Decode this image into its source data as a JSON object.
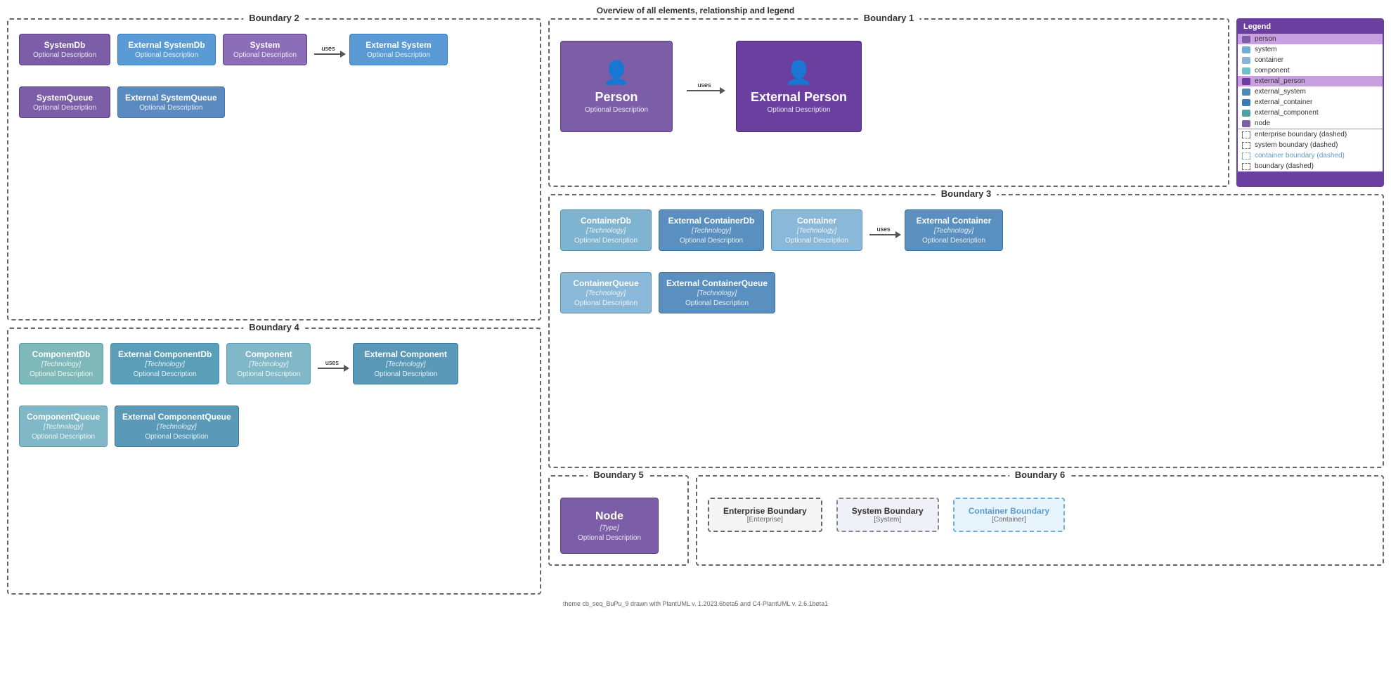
{
  "page": {
    "title": "Overview of all elements, relationship and legend"
  },
  "legend": {
    "header": "Legend",
    "items": [
      {
        "label": "person",
        "type": "person"
      },
      {
        "label": "system",
        "type": "system"
      },
      {
        "label": "container",
        "type": "container"
      },
      {
        "label": "component",
        "type": "component"
      },
      {
        "label": "external_person",
        "type": "ext-person"
      },
      {
        "label": "external_system",
        "type": "ext-system"
      },
      {
        "label": "external_container",
        "type": "ext-container"
      },
      {
        "label": "external_component",
        "type": "ext-component"
      },
      {
        "label": "node",
        "type": "node"
      }
    ],
    "boundaries": [
      {
        "label": "enterprise boundary (dashed)",
        "type": "default"
      },
      {
        "label": "system boundary (dashed)",
        "type": "default"
      },
      {
        "label": "container boundary (dashed)",
        "type": "container"
      },
      {
        "label": "boundary (dashed)",
        "type": "default"
      }
    ]
  },
  "boundary1": {
    "title": "Boundary 1",
    "person": {
      "name": "Person",
      "desc": "Optional Description"
    },
    "arrow_label": "uses",
    "ext_person": {
      "name": "External Person",
      "desc": "Optional Description"
    }
  },
  "boundary2": {
    "title": "Boundary 2",
    "systemdb": {
      "name": "SystemDb",
      "desc": "Optional Description"
    },
    "ext_systemdb": {
      "name": "External SystemDb",
      "desc": "Optional Description"
    },
    "system": {
      "name": "System",
      "desc": "Optional Description"
    },
    "arrow_label": "uses",
    "ext_system": {
      "name": "External System",
      "desc": "Optional Description"
    },
    "systemqueue": {
      "name": "SystemQueue",
      "desc": "Optional Description"
    },
    "ext_systemqueue": {
      "name": "External SystemQueue",
      "desc": "Optional Description"
    }
  },
  "boundary3": {
    "title": "Boundary 3",
    "containerdb": {
      "name": "ContainerDb",
      "tech": "[Technology]",
      "desc": "Optional Description"
    },
    "ext_containerdb": {
      "name": "External ContainerDb",
      "tech": "[Technology]",
      "desc": "Optional Description"
    },
    "container": {
      "name": "Container",
      "tech": "[Technology]",
      "desc": "Optional Description"
    },
    "arrow_label": "uses",
    "ext_container": {
      "name": "External Container",
      "tech": "[Technology]",
      "desc": "Optional Description"
    },
    "containerqueue": {
      "name": "ContainerQueue",
      "tech": "[Technology]",
      "desc": "Optional Description"
    },
    "ext_containerqueue": {
      "name": "External ContainerQueue",
      "tech": "[Technology]",
      "desc": "Optional Description"
    }
  },
  "boundary4": {
    "title": "Boundary 4",
    "componentdb": {
      "name": "ComponentDb",
      "tech": "[Technology]",
      "desc": "Optional Description"
    },
    "ext_componentdb": {
      "name": "External ComponentDb",
      "tech": "[Technology]",
      "desc": "Optional Description"
    },
    "component": {
      "name": "Component",
      "tech": "[Technology]",
      "desc": "Optional Description"
    },
    "arrow_label": "uses",
    "ext_component": {
      "name": "External Component",
      "tech": "[Technology]",
      "desc": "Optional Description"
    },
    "componentqueue": {
      "name": "ComponentQueue",
      "tech": "[Technology]",
      "desc": "Optional Description"
    },
    "ext_componentqueue": {
      "name": "External ComponentQueue",
      "tech": "[Technology]",
      "desc": "Optional Description"
    }
  },
  "boundary5": {
    "title": "Boundary 5",
    "node": {
      "name": "Node",
      "tech": "[Type]",
      "desc": "Optional Description"
    }
  },
  "boundary6": {
    "title": "Boundary 6",
    "enterprise": {
      "name": "Enterprise Boundary",
      "sub": "[Enterprise]"
    },
    "system": {
      "name": "System Boundary",
      "sub": "[System]"
    },
    "container": {
      "name": "Container Boundary",
      "sub": "[Container]"
    }
  },
  "footer": {
    "text": "theme cb_seq_BuPu_9 drawn with PlantUML v. 1.2023.6beta5 and C4-PlantUML v. 2.6.1beta1"
  }
}
